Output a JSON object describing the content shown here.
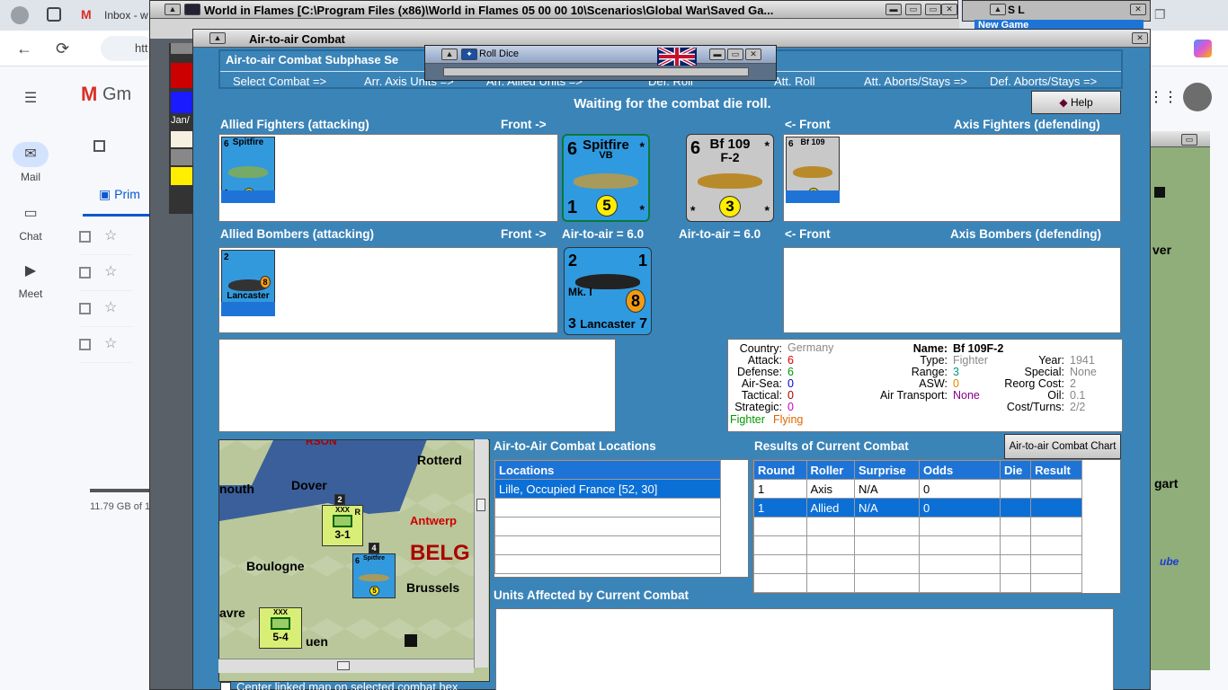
{
  "browser": {
    "tab_label": "Inbox - w",
    "url_fragment": "htt"
  },
  "gmail": {
    "brand": "Gm",
    "nav": [
      {
        "label": "Mail"
      },
      {
        "label": "Chat"
      },
      {
        "label": "Meet"
      }
    ],
    "tab_primary": "Prim",
    "storage": "11.79 GB of 1"
  },
  "wif": {
    "main_title": "World in Flames [C:\\Program Files (x86)\\World in Flames 05 00 00 10\\Scenarios\\Global War\\Saved Ga...",
    "sl_title": "S L",
    "sl_sub": "New Game",
    "strip_label": "Jan/"
  },
  "dialog": {
    "title": "Air-to-air Combat",
    "subphase_title": "Air-to-air Combat Subphase Se",
    "subphases": [
      "Select Combat =>",
      "Arr. Axis Units =>",
      "Arr. Allied Units =>",
      "Def. Roll",
      "Att. Roll",
      "Att. Aborts/Stays =>",
      "Def. Aborts/Stays =>"
    ],
    "status": "Waiting for the combat die roll.",
    "help_label": "Help",
    "allied_fighters_label": "Allied Fighters (attacking)",
    "front_right": "Front ->",
    "front_left": "<- Front",
    "axis_fighters_label": "Axis Fighters (defending)",
    "allied_bombers_label": "Allied Bombers (attacking)",
    "axis_bombers_label": "Axis Bombers (defending)",
    "att_air_to_air": "Air-to-air = 6.0",
    "def_air_to_air": "Air-to-air = 6.0",
    "counters": {
      "spitfire": {
        "name": "Spitfire",
        "sub": "VB",
        "top_left": "6",
        "top_right": "*",
        "bottom_left": "1",
        "coin": "5",
        "bottom_right": "*"
      },
      "bf109": {
        "name": "Bf 109",
        "sub": "F-2",
        "top_left": "6",
        "top_right": "*",
        "bottom_left": "*",
        "coin": "3",
        "bottom_right": "*"
      },
      "lancaster": {
        "name": "Lancaster",
        "sub": "Mk. I",
        "top_left": "2",
        "top_right": "1",
        "bottom_left": "3",
        "coin": "8",
        "bottom_right": "7"
      }
    },
    "info": {
      "country_k": "Country:",
      "country_v": "Germany",
      "attack_k": "Attack:",
      "attack_v": "6",
      "defense_k": "Defense:",
      "defense_v": "6",
      "airsea_k": "Air-Sea:",
      "airsea_v": "0",
      "tactical_k": "Tactical:",
      "tactical_v": "0",
      "strategic_k": "Strategic:",
      "strategic_v": "0",
      "flying_a": "Fighter",
      "flying_b": "Flying",
      "name_k": "Name:",
      "name_v": "Bf 109F-2",
      "type_k": "Type:",
      "type_v": "Fighter",
      "range_k": "Range:",
      "range_v": "3",
      "asw_k": "ASW:",
      "asw_v": "0",
      "airtransport_k": "Air Transport:",
      "airtransport_v": "None",
      "year_k": "Year:",
      "year_v": "1941",
      "special_k": "Special:",
      "special_v": "None",
      "reorg_k": "Reorg Cost:",
      "reorg_v": "2",
      "oil_k": "Oil:",
      "oil_v": "0.1",
      "costturns_k": "Cost/Turns:",
      "costturns_v": "2/2"
    },
    "map": {
      "labels": [
        "Dover",
        "nouth",
        "Rotterd",
        "Antwerp",
        "BELG",
        "Boulogne",
        "Brussels",
        "avre",
        "uen",
        "RSON"
      ],
      "unit1": {
        "top": "XXX",
        "bottom": "3-1",
        "corner": "2",
        "side": "R"
      },
      "unit2": {
        "top": "XXX",
        "bottom": "5-4"
      },
      "spitfire_small": {
        "name": "Spitfire",
        "sub": "VB",
        "num": "6",
        "coin": "5",
        "corner": "4"
      }
    },
    "locations_title": "Air-to-Air Combat Locations",
    "locations_header": "Locations",
    "locations": [
      "Lille, Occupied France [52, 30]"
    ],
    "results_title": "Results of Current Combat",
    "chart_button": "Air-to-air Combat Chart",
    "results_headers": [
      "Round",
      "Roller",
      "Surprise",
      "Odds",
      "Die",
      "Result"
    ],
    "results_rows": [
      [
        "1",
        "Axis",
        "N/A",
        "0",
        "",
        ""
      ],
      [
        "1",
        "Allied",
        "N/A",
        "0",
        "",
        ""
      ]
    ],
    "units_affected_title": "Units Affected by Current Combat",
    "center_checkbox": "Center linked map on selected combat hex"
  },
  "dice": {
    "title": "Roll Dice"
  },
  "right_map": {
    "labels": [
      "ver",
      "gart",
      "ube"
    ]
  }
}
